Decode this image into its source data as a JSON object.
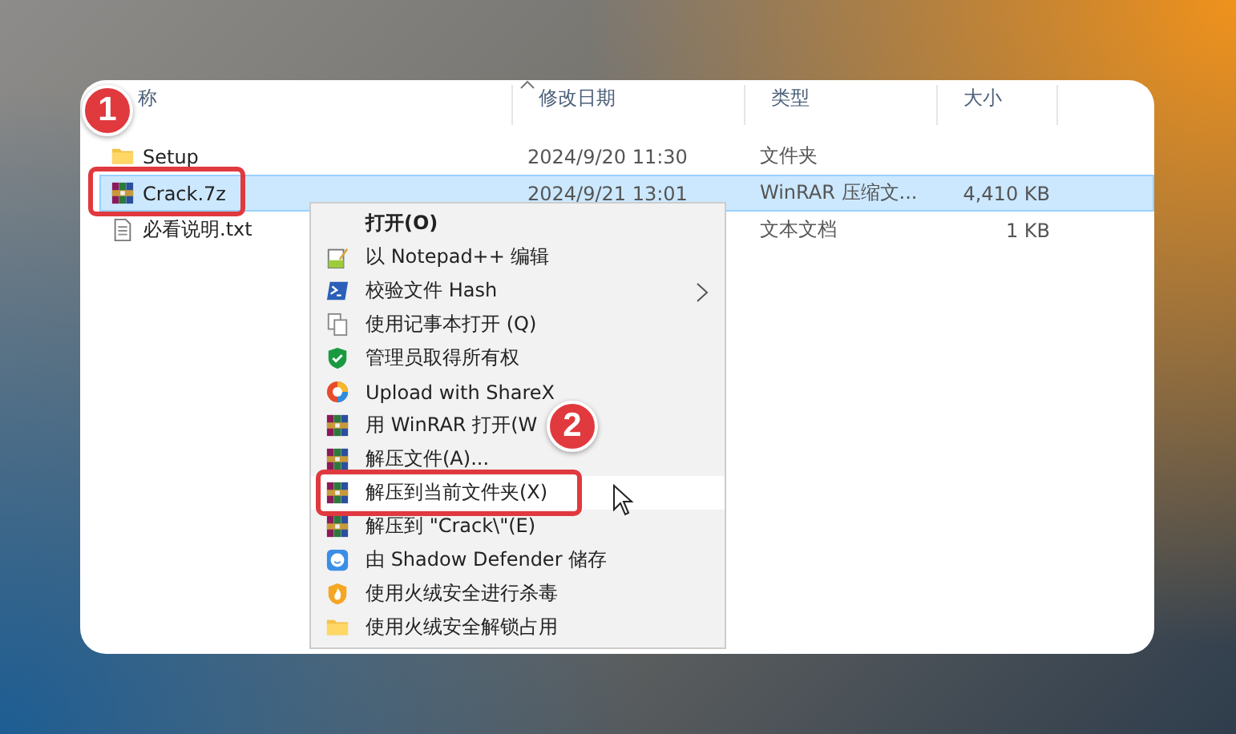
{
  "annotations": [
    {
      "label": "1"
    },
    {
      "label": "2"
    }
  ],
  "file_list": {
    "columns": [
      {
        "label": "称"
      },
      {
        "label": "修改日期"
      },
      {
        "label": "类型"
      },
      {
        "label": "大小"
      }
    ],
    "rows": [
      {
        "kind": "folder",
        "name": "Setup",
        "modified": "2024/9/20 11:30",
        "type": "文件夹",
        "size": "",
        "selected": false,
        "annotated": false
      },
      {
        "kind": "archive",
        "name": "Crack.7z",
        "modified": "2024/9/21 13:01",
        "type": "WinRAR 压缩文...",
        "size": "4,410 KB",
        "selected": true,
        "annotated": true
      },
      {
        "kind": "text",
        "name": "必看说明.txt",
        "modified": "",
        "type": "文本文档",
        "size": "1 KB",
        "selected": false,
        "annotated": false
      }
    ]
  },
  "context_menu": {
    "items": [
      {
        "kind": "none",
        "label": "打开(O)",
        "bold": true,
        "submenu": false,
        "hovered": false,
        "annotated": false
      },
      {
        "kind": "notepad",
        "label": "以 Notepad++ 编辑",
        "bold": false,
        "submenu": false,
        "hovered": false,
        "annotated": false
      },
      {
        "kind": "terminal",
        "label": "校验文件 Hash",
        "bold": false,
        "submenu": true,
        "hovered": false,
        "annotated": false
      },
      {
        "kind": "copy",
        "label": "使用记事本打开 (Q)",
        "bold": false,
        "submenu": false,
        "hovered": false,
        "annotated": false
      },
      {
        "kind": "shield",
        "label": "管理员取得所有权",
        "bold": false,
        "submenu": false,
        "hovered": false,
        "annotated": false
      },
      {
        "kind": "sharex",
        "label": "Upload with ShareX",
        "bold": false,
        "submenu": false,
        "hovered": false,
        "annotated": false
      },
      {
        "kind": "archive",
        "label": "用 WinRAR 打开(W",
        "bold": false,
        "submenu": false,
        "hovered": false,
        "annotated": false
      },
      {
        "kind": "archive",
        "label": "解压文件(A)...",
        "bold": false,
        "submenu": false,
        "hovered": false,
        "annotated": false
      },
      {
        "kind": "archive",
        "label": "解压到当前文件夹(X)",
        "bold": false,
        "submenu": false,
        "hovered": true,
        "annotated": true
      },
      {
        "kind": "archive",
        "label": "解压到 \"Crack\\\"(E)",
        "bold": false,
        "submenu": false,
        "hovered": false,
        "annotated": false
      },
      {
        "kind": "shadow",
        "label": "由 Shadow Defender 储存",
        "bold": false,
        "submenu": false,
        "hovered": false,
        "annotated": false
      },
      {
        "kind": "flame",
        "label": "使用火绒安全进行杀毒",
        "bold": false,
        "submenu": false,
        "hovered": false,
        "annotated": false
      },
      {
        "kind": "folder",
        "label": "使用火绒安全解锁占用",
        "bold": false,
        "submenu": false,
        "hovered": false,
        "annotated": false
      }
    ]
  }
}
